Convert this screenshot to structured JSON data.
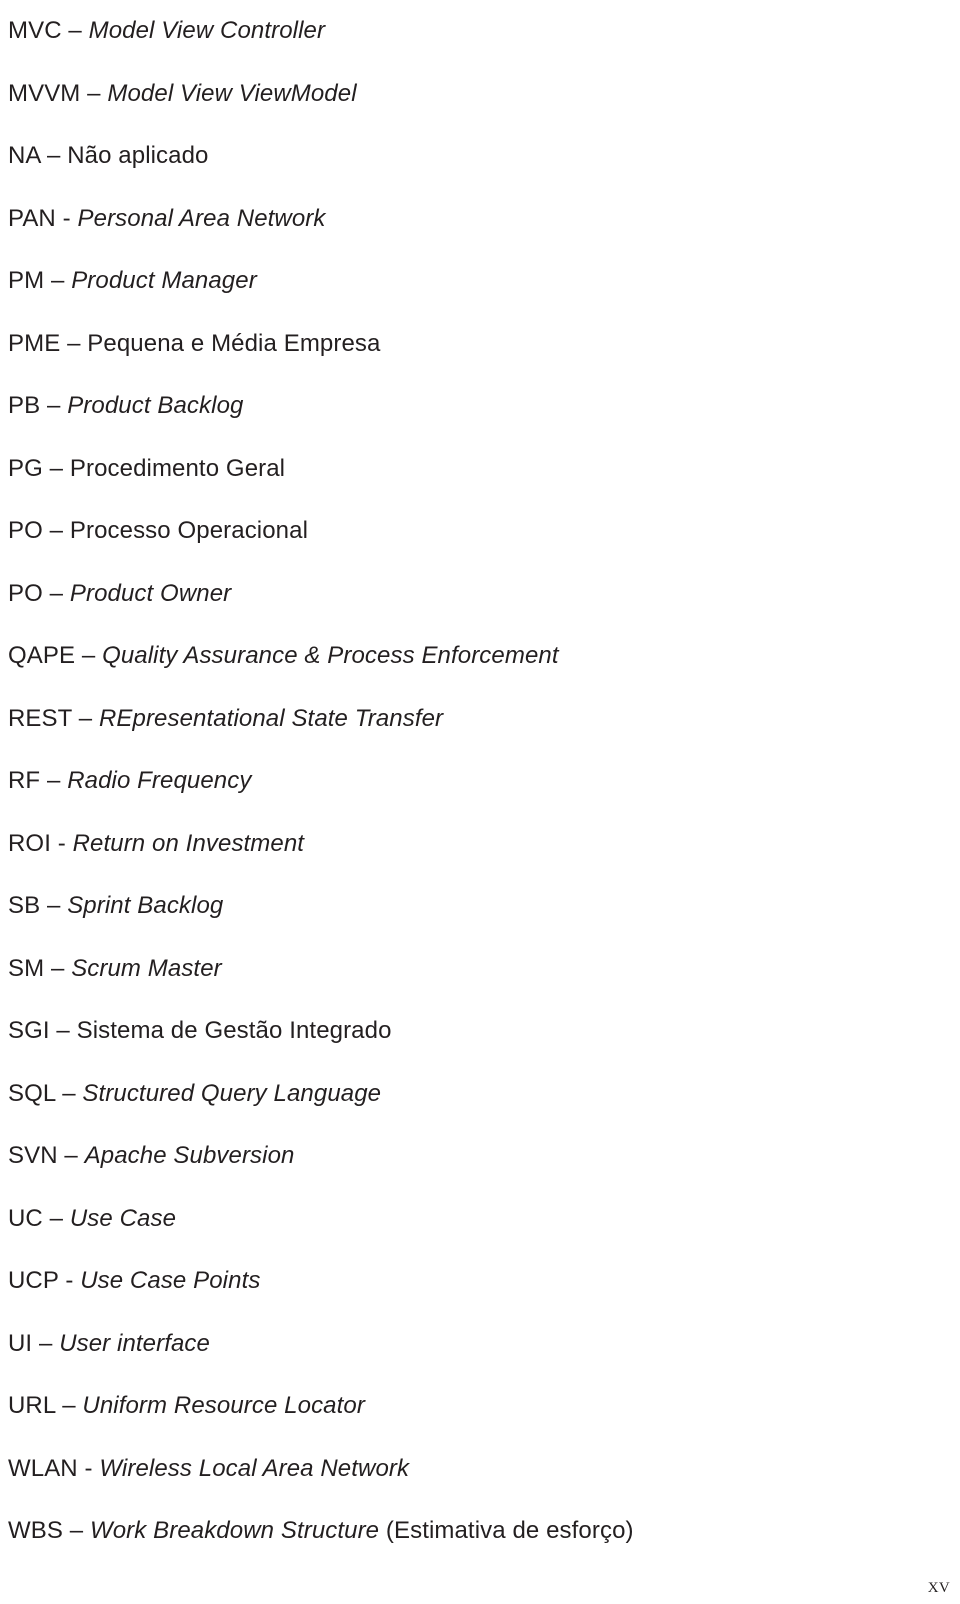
{
  "document": {
    "type": "glossary-page",
    "page_number": "xv",
    "text_color": "#231f20",
    "background_color": "#ffffff"
  },
  "glossary": {
    "entries": [
      {
        "term": "MVC",
        "sep": " – ",
        "definition": "Model View Controller",
        "italic": true,
        "note": ""
      },
      {
        "term": "MVVM",
        "sep": " – ",
        "definition": "Model View ViewModel",
        "italic": true,
        "note": ""
      },
      {
        "term": "NA",
        "sep": " – ",
        "definition": "Não aplicado",
        "italic": false,
        "note": ""
      },
      {
        "term": "PAN",
        "sep": " - ",
        "definition": "Personal Area Network",
        "italic": true,
        "note": ""
      },
      {
        "term": "PM",
        "sep": " – ",
        "definition": "Product Manager",
        "italic": true,
        "note": ""
      },
      {
        "term": "PME",
        "sep": " – ",
        "definition": "Pequena e Média Empresa",
        "italic": false,
        "note": ""
      },
      {
        "term": "PB",
        "sep": " – ",
        "definition": "Product Backlog",
        "italic": true,
        "note": ""
      },
      {
        "term": "PG",
        "sep": " – ",
        "definition": "Procedimento Geral",
        "italic": false,
        "note": ""
      },
      {
        "term": "PO",
        "sep": " – ",
        "definition": "Processo Operacional",
        "italic": false,
        "note": ""
      },
      {
        "term": "PO",
        "sep": " – ",
        "definition": "Product Owner",
        "italic": true,
        "note": ""
      },
      {
        "term": "QAPE",
        "sep": " – ",
        "definition": "Quality Assurance & Process Enforcement",
        "italic": true,
        "note": ""
      },
      {
        "term": "REST",
        "sep": " – ",
        "definition": "REpresentational State Transfer",
        "italic": true,
        "note": ""
      },
      {
        "term": "RF",
        "sep": " – ",
        "definition": "Radio Frequency",
        "italic": true,
        "note": ""
      },
      {
        "term": "ROI",
        "sep": " - ",
        "definition": "Return on Investment",
        "italic": true,
        "note": ""
      },
      {
        "term": "SB",
        "sep": " – ",
        "definition": "Sprint Backlog",
        "italic": true,
        "note": ""
      },
      {
        "term": "SM",
        "sep": " – ",
        "definition": "Scrum Master",
        "italic": true,
        "note": ""
      },
      {
        "term": "SGI",
        "sep": " – ",
        "definition": "Sistema de Gestão Integrado",
        "italic": false,
        "note": ""
      },
      {
        "term": "SQL",
        "sep": " – ",
        "definition": "Structured Query Language",
        "italic": true,
        "note": ""
      },
      {
        "term": "SVN",
        "sep": " – ",
        "definition": "Apache Subversion",
        "italic": true,
        "note": ""
      },
      {
        "term": "UC",
        "sep": " – ",
        "definition": "Use Case",
        "italic": true,
        "note": ""
      },
      {
        "term": "UCP",
        "sep": " - ",
        "definition": "Use Case Points",
        "italic": true,
        "note": ""
      },
      {
        "term": "UI",
        "sep": " – ",
        "definition": "User interface",
        "italic": true,
        "note": ""
      },
      {
        "term": "URL",
        "sep": " – ",
        "definition": "Uniform Resource Locator",
        "italic": true,
        "note": ""
      },
      {
        "term": "WLAN",
        "sep": " - ",
        "definition": "Wireless Local Area Network",
        "italic": true,
        "note": ""
      },
      {
        "term": "WBS",
        "sep": " – ",
        "definition": "Work Breakdown Structure",
        "italic": true,
        "note": " (Estimativa de esforço)"
      }
    ]
  }
}
